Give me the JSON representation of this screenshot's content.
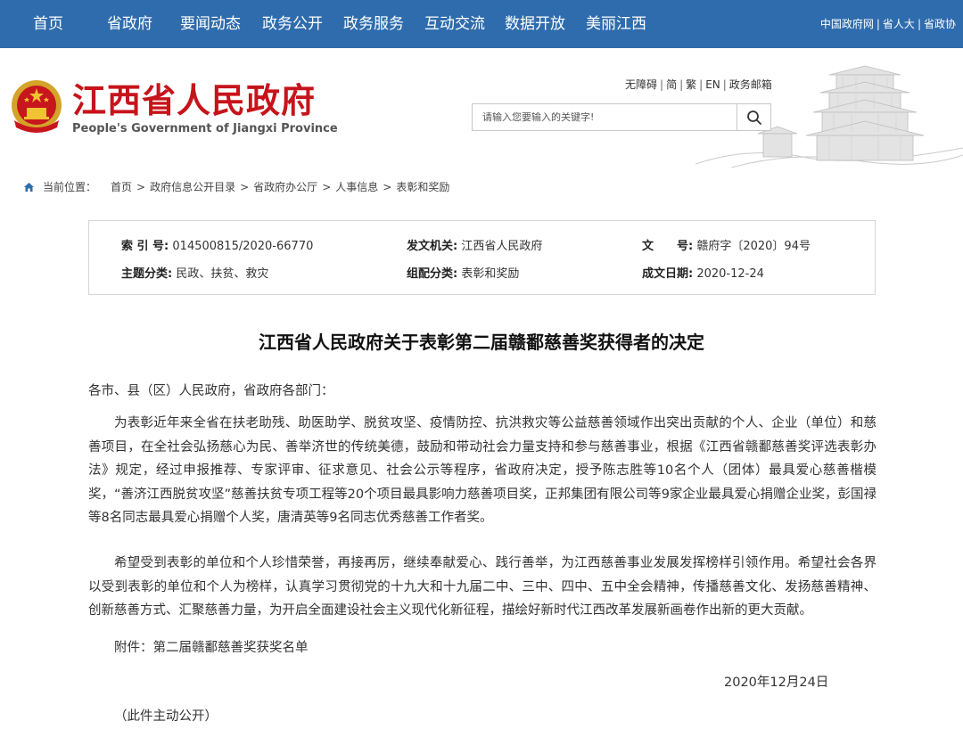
{
  "nav": {
    "items": [
      "首页",
      "省政府",
      "要闻动态",
      "政务公开",
      "政务服务",
      "互动交流",
      "数据开放",
      "美丽江西"
    ],
    "top_links": [
      "中国政府网",
      "省人大",
      "省政协"
    ]
  },
  "header": {
    "title": "江西省人民政府",
    "subtitle": "People's Government of Jiangxi Province",
    "util_links": [
      "无障碍",
      "简",
      "繁",
      "EN",
      "政务邮箱"
    ],
    "search_placeholder": "请输入您要输入的关键字!"
  },
  "breadcrumb": {
    "label": "当前位置：",
    "items": [
      "首页",
      "政府信息公开目录",
      "省政府办公厅",
      "人事信息",
      "表彰和奖励"
    ]
  },
  "meta": {
    "index_label": "索 引 号:",
    "index_value": "014500815/2020-66770",
    "issuer_label": "发文机关:",
    "issuer_value": "江西省人民政府",
    "docno_label": "文　　号:",
    "docno_value": "赣府字〔2020〕94号",
    "topic_label": "主题分类:",
    "topic_value": "民政、扶贫、救灾",
    "group_label": "组配分类:",
    "group_value": "表彰和奖励",
    "date_label": "成文日期:",
    "date_value": "2020-12-24"
  },
  "article": {
    "title": "江西省人民政府关于表彰第二届赣鄱慈善奖获得者的决定",
    "salutation": "各市、县（区）人民政府，省政府各部门：",
    "paragraph1": "为表彰近年来全省在扶老助残、助医助学、脱贫攻坚、疫情防控、抗洪救灾等公益慈善领域作出突出贡献的个人、企业（单位）和慈善项目，在全社会弘扬慈心为民、善举济世的传统美德，鼓励和带动社会力量支持和参与慈善事业，根据《江西省赣鄱慈善奖评选表彰办法》规定，经过申报推荐、专家评审、征求意见、社会公示等程序，省政府决定，授予陈志胜等10名个人（团体）最具爱心慈善楷模奖，“善济江西脱贫攻坚”慈善扶贫专项工程等20个项目最具影响力慈善项目奖，正邦集团有限公司等9家企业最具爱心捐赠企业奖，彭国禄等8名同志最具爱心捐赠个人奖，唐清英等9名同志优秀慈善工作者奖。",
    "paragraph2": "希望受到表彰的单位和个人珍惜荣誉，再接再厉，继续奉献爱心、践行善举，为江西慈善事业发展发挥榜样引领作用。希望社会各界以受到表彰的单位和个人为榜样，认真学习贯彻党的十九大和十九届二中、三中、四中、五中全会精神，传播慈善文化、发扬慈善精神、创新慈善方式、汇聚慈善力量，为开启全面建设社会主义现代化新征程，描绘好新时代江西改革发展新画卷作出新的更大贡献。",
    "attachment": "附件：第二届赣鄱慈善奖获奖名单",
    "date": "2020年12月24日",
    "note": "（此件主动公开）"
  },
  "colors": {
    "nav_bg": "#2f6cad",
    "title_red": "#c6141b"
  },
  "icons": {
    "emblem": "national-emblem-icon",
    "search": "search-icon",
    "home": "home-icon",
    "header_art": "pavilion-illustration"
  }
}
